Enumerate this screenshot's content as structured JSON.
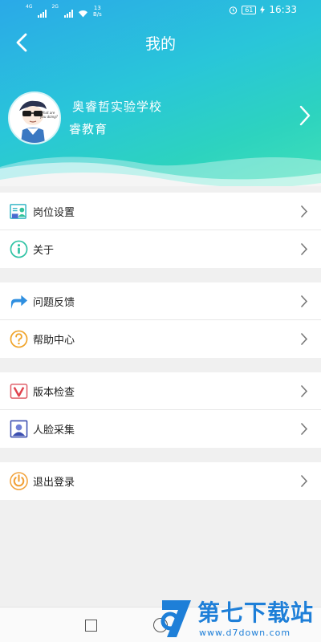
{
  "status_bar": {
    "net1": "4G",
    "net2": "2G",
    "speed_value": "13",
    "speed_unit": "B/s",
    "battery": "61",
    "time": "16:33"
  },
  "header": {
    "title": "我的",
    "back_icon": "chevron-left-icon"
  },
  "profile": {
    "school": "奥睿哲实验学校",
    "org": "睿教育",
    "avatar_caption": "What are you doing?"
  },
  "menu_groups": [
    [
      {
        "label": "岗位设置",
        "icon": "id-card-icon"
      },
      {
        "label": "关于",
        "icon": "info-icon"
      }
    ],
    [
      {
        "label": "问题反馈",
        "icon": "share-arrow-icon"
      },
      {
        "label": "帮助中心",
        "icon": "help-icon"
      }
    ],
    [
      {
        "label": "版本检查",
        "icon": "version-icon"
      },
      {
        "label": "人脸采集",
        "icon": "face-capture-icon"
      }
    ],
    [
      {
        "label": "退出登录",
        "icon": "power-icon"
      }
    ]
  ],
  "watermark": {
    "brand": "第七下载站",
    "url": "www.d7down.com"
  },
  "colors": {
    "header_gradient_start": "#2aa9e8",
    "header_gradient_end": "#40e0b8",
    "brand_blue": "#1e7fd8"
  }
}
